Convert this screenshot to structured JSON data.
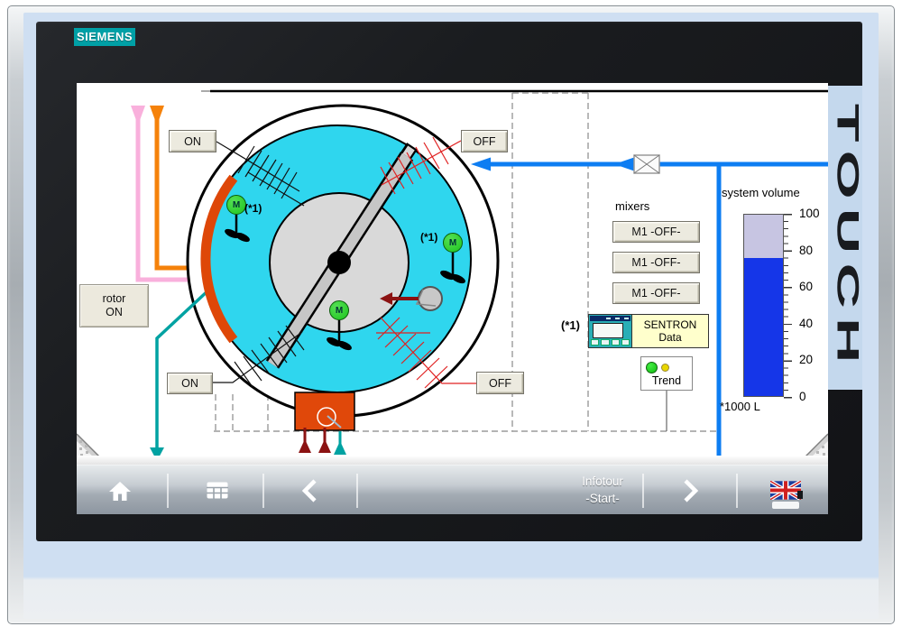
{
  "device": {
    "brand": "SIEMENS",
    "bezel_label": "TOUCH"
  },
  "colors": {
    "brand_teal": "#00A0A6",
    "tank_cyan": "#2FD6EE",
    "pipe_blue": "#0D7DF2",
    "gauge_fill_blue": "#1536E8",
    "gauge_empty_lavender": "#C7C5E2",
    "rotor_orange": "#DE4708",
    "mixer_green": "#22CC22",
    "alarm_red": "#E02020",
    "flow_pink": "#F9B0DC",
    "flow_orange": "#F5820B",
    "flow_teal": "#00A2A2",
    "dark_red": "#8B1212"
  },
  "screen": {
    "process": {
      "rotor_status": {
        "line1": "rotor",
        "line2": "ON"
      },
      "skimmer_top_on": "ON",
      "skimmer_top_off": "OFF",
      "skimmer_bottom_on": "ON",
      "skimmer_bottom_off": "OFF",
      "motor_letter": "M",
      "footnote_ref": "(*1)"
    },
    "mixers": {
      "label": "mixers",
      "buttons": [
        "M1 -OFF-",
        "M1 -OFF-",
        "M1 -OFF-"
      ]
    },
    "sentron": {
      "footnote": "(*1)",
      "label_line1": "SENTRON",
      "label_line2": "Data"
    },
    "trend": {
      "label": "Trend"
    },
    "gauge": {
      "title": "system volume",
      "unit": "*1000 L",
      "tick_labels": [
        "100",
        "80",
        "60",
        "40",
        "20",
        "0"
      ],
      "value_percent": 76
    },
    "nav": {
      "infotour_line1": "Infotour",
      "infotour_line2": "-Start-",
      "icons": [
        "home-icon",
        "menu-grid-icon",
        "chevron-left-icon",
        "chevron-right-icon",
        "uk-flag-icon"
      ]
    }
  }
}
